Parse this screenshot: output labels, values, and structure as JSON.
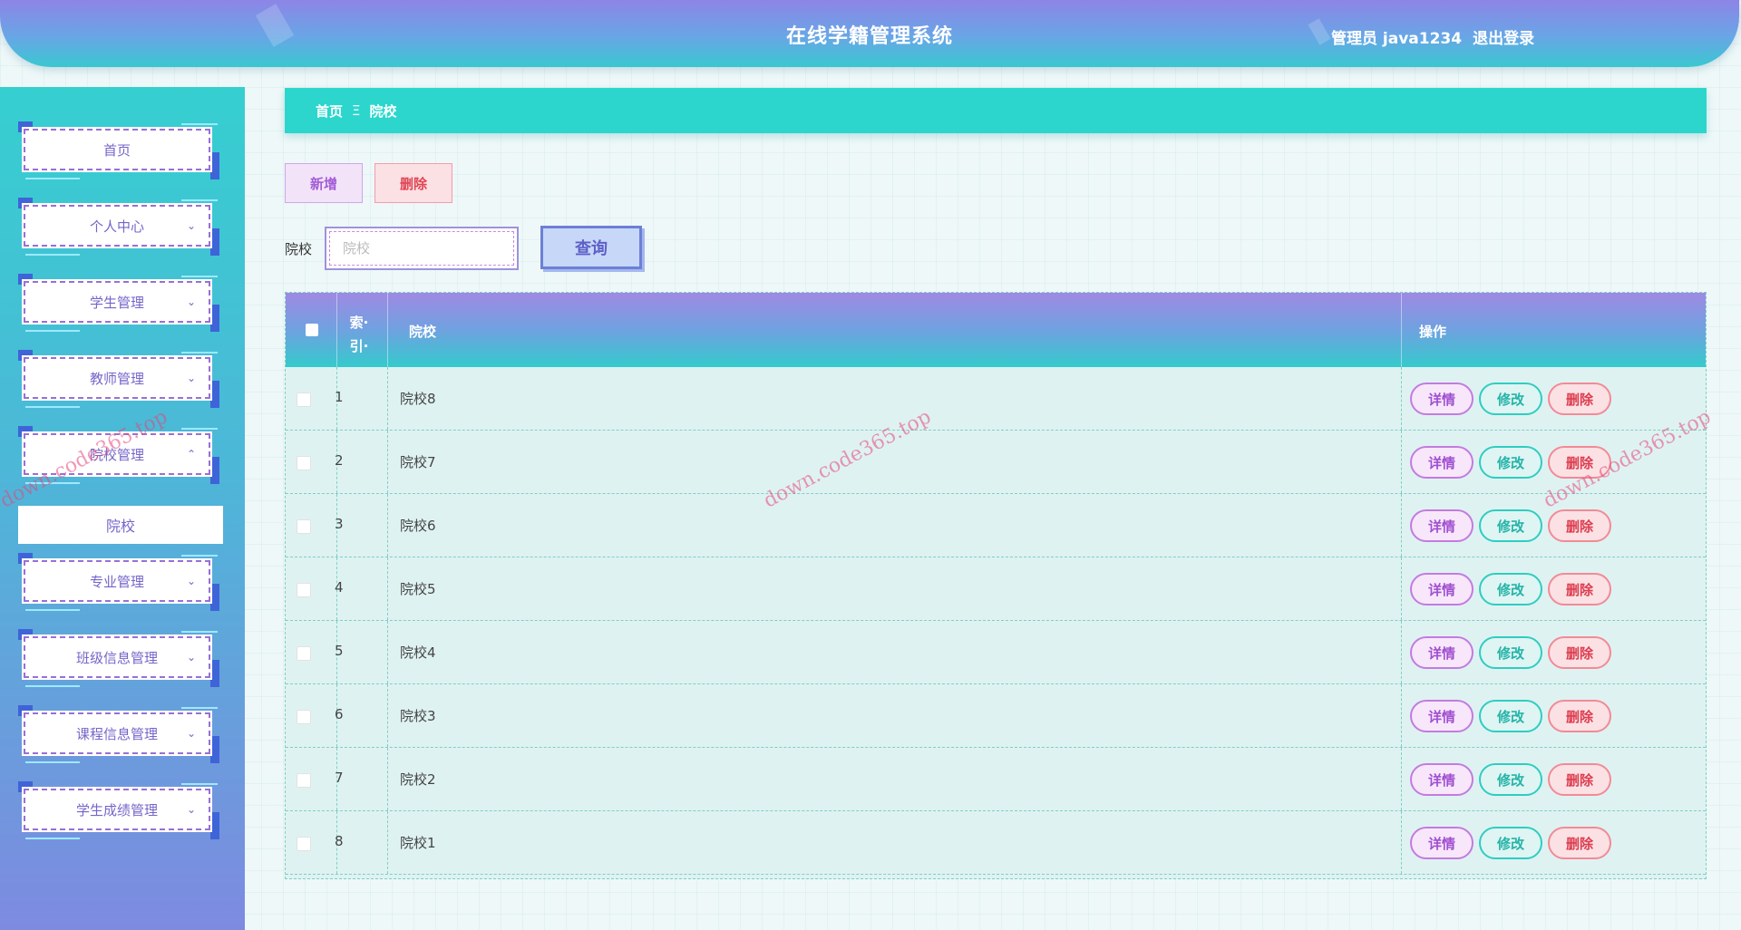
{
  "header": {
    "title": "在线学籍管理系统",
    "user": "管理员 java1234",
    "logout": "退出登录"
  },
  "sidebar": {
    "items": [
      {
        "label": "首页",
        "chevron": ""
      },
      {
        "label": "个人中心",
        "chevron": "⌄"
      },
      {
        "label": "学生管理",
        "chevron": "⌄"
      },
      {
        "label": "教师管理",
        "chevron": "⌄"
      },
      {
        "label": "院校管理",
        "chevron": "⌃"
      },
      {
        "label": "专业管理",
        "chevron": "⌄"
      },
      {
        "label": "班级信息管理",
        "chevron": "⌄"
      },
      {
        "label": "课程信息管理",
        "chevron": "⌄"
      },
      {
        "label": "学生成绩管理",
        "chevron": "⌄"
      }
    ],
    "active_sub": "院校"
  },
  "breadcrumb": {
    "home": "首页",
    "sep": "Ξ",
    "current": "院校"
  },
  "toolbar": {
    "add_label": "新增",
    "delete_label": "删除"
  },
  "search": {
    "label": "院校",
    "placeholder": "院校",
    "value": "",
    "button": "查询"
  },
  "table": {
    "headers": {
      "index_line1": "索·",
      "index_line2": "引·",
      "school": "院校",
      "ops": "操作"
    },
    "rows": [
      {
        "index": "1",
        "school": "院校8"
      },
      {
        "index": "2",
        "school": "院校7"
      },
      {
        "index": "3",
        "school": "院校6"
      },
      {
        "index": "4",
        "school": "院校5"
      },
      {
        "index": "5",
        "school": "院校4"
      },
      {
        "index": "6",
        "school": "院校3"
      },
      {
        "index": "7",
        "school": "院校2"
      },
      {
        "index": "8",
        "school": "院校1"
      }
    ],
    "row_actions": {
      "detail": "详情",
      "edit": "修改",
      "remove": "删除"
    }
  },
  "watermark": "down.code365.top",
  "colors": {
    "accent": "#2cd6cd",
    "purple": "#9b6fd6",
    "danger": "#e04452"
  }
}
